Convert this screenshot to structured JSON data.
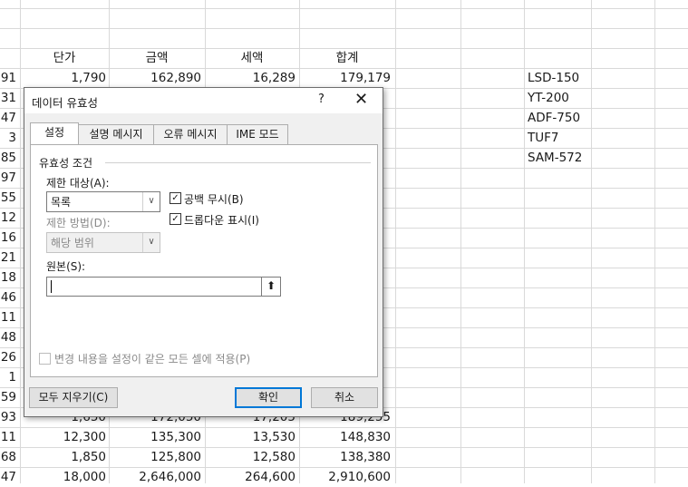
{
  "sheet": {
    "headers": {
      "col_a": "",
      "unit_price": "단가",
      "amount": "금액",
      "tax": "세액",
      "total": "합계"
    },
    "rows": [
      {
        "a": "91",
        "b": "1,790",
        "c": "162,890",
        "d": "16,289",
        "e": "179,179"
      },
      {
        "a": "31"
      },
      {
        "a": "47"
      },
      {
        "a": "3"
      },
      {
        "a": "85"
      },
      {
        "a": "97"
      },
      {
        "a": "55"
      },
      {
        "a": "12"
      },
      {
        "a": "16"
      },
      {
        "a": "21"
      },
      {
        "a": "18"
      },
      {
        "a": "46"
      },
      {
        "a": "11"
      },
      {
        "a": "48"
      },
      {
        "a": "26"
      },
      {
        "a": "1"
      },
      {
        "a": "59"
      },
      {
        "a": "93",
        "b": "1,650",
        "c": "172,050",
        "d": "17,205",
        "e": "189,255"
      },
      {
        "a": "11",
        "b": "12,300",
        "c": "135,300",
        "d": "13,530",
        "e": "148,830"
      },
      {
        "a": "68",
        "b": "1,850",
        "c": "125,800",
        "d": "12,580",
        "e": "138,380"
      },
      {
        "a": "47",
        "b": "18,000",
        "c": "2,646,000",
        "d": "264,600",
        "e": "2,910,600"
      }
    ],
    "codes": [
      "LSD-150",
      "YT-200",
      "ADF-750",
      "TUF7",
      "SAM-572"
    ]
  },
  "dialog": {
    "title": "데이터 유효성",
    "help": "?",
    "close": "✕",
    "tabs": [
      "설정",
      "설명 메시지",
      "오류 메시지",
      "IME 모드"
    ],
    "group_title": "유효성 조건",
    "allow_label": "제한 대상(A):",
    "allow_value": "목록",
    "data_label": "제한 방법(D):",
    "data_value": "해당 범위",
    "ignore_blank": "공백 무시(B)",
    "in_cell_dropdown": "드롭다운 표시(I)",
    "source_label": "원본(S):",
    "source_value": "",
    "apply_all": "변경 내용을 설정이 같은 모든 셀에 적용(P)",
    "clear_all": "모두 지우기(C)",
    "ok": "확인",
    "cancel": "취소",
    "check_mark": "✓",
    "drop_arrow": "∨",
    "pick_arrow": "⬆"
  }
}
